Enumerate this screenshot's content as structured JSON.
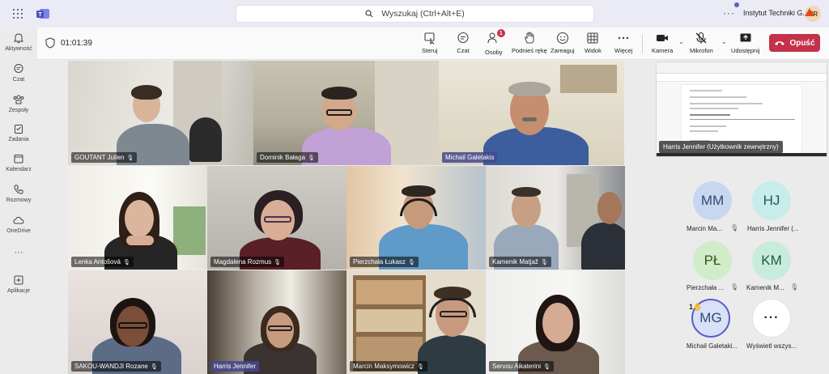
{
  "app": {
    "search_placeholder": "Wyszukaj (Ctrl+Alt+E)",
    "org_name": "Instytut Techniki G...",
    "user_initials": "MR",
    "more": "···"
  },
  "rail": [
    {
      "label": "Aktywność",
      "icon": "bell-icon"
    },
    {
      "label": "Czat",
      "icon": "chat-icon"
    },
    {
      "label": "Zespoły",
      "icon": "teams-icon"
    },
    {
      "label": "Zadania",
      "icon": "tasks-icon"
    },
    {
      "label": "Kalendarz",
      "icon": "calendar-icon"
    },
    {
      "label": "Rozmowy",
      "icon": "phone-icon"
    },
    {
      "label": "OneDrive",
      "icon": "cloud-icon"
    },
    {
      "label": "···",
      "icon": "more-icon"
    },
    {
      "label": "Aplikacje",
      "icon": "add-app-icon"
    }
  ],
  "meeting": {
    "timer": "01:01:39",
    "buttons": {
      "steruj": "Steruj",
      "czat": "Czat",
      "osoby": "Osoby",
      "osoby_badge": "1",
      "podnies": "Podnieś rękę",
      "zareaguj": "Zareaguj",
      "widok": "Widok",
      "wiecej": "Więcej",
      "kamera": "Kamera",
      "mikrofon": "Mikrofon",
      "udostepnij": "Udostępnij",
      "opusc": "Opuść"
    }
  },
  "tiles": [
    {
      "name": "GOUTANT Julien"
    },
    {
      "name": "Dominik Bałaga"
    },
    {
      "name": "Michail Galetakis"
    },
    {
      "name": "Lenka Antošová"
    },
    {
      "name": "Magdalena Rozmus"
    },
    {
      "name": "Pierzchała Łukasz"
    },
    {
      "name": "Kamenik Matjaž"
    },
    {
      "name": "SAKOU-WANDJI Rozane"
    },
    {
      "name": "Harris Jennifer"
    },
    {
      "name": "Marcin Maksymowicz"
    },
    {
      "name": "Servou Aikaterini"
    }
  ],
  "shared_screen": {
    "presenter_label": "Harris Jennifer (Użytkownik zewnętrzny)"
  },
  "avatars": [
    {
      "initials": "MM",
      "name": "Marcin Ma...",
      "color": "#c7d7ef",
      "text_color": "#2f4a7a"
    },
    {
      "initials": "HJ",
      "name": "Harris Jennifer (...",
      "color": "#c8ecea",
      "text_color": "#1d5c58"
    },
    {
      "initials": "PŁ",
      "name": "Pierzchała ...",
      "color": "#d0ecc8",
      "text_color": "#2e5a22"
    },
    {
      "initials": "KM",
      "name": "Kamenik M...",
      "color": "#c8ecdc",
      "text_color": "#1e5c40"
    },
    {
      "initials": "MG",
      "name": "Michail Galetaki...",
      "color": "#d8e1f5",
      "text_color": "#2f4a7a",
      "hand_count": "1"
    },
    {
      "initials": "···",
      "name": "Wyświetl wszys..."
    }
  ]
}
